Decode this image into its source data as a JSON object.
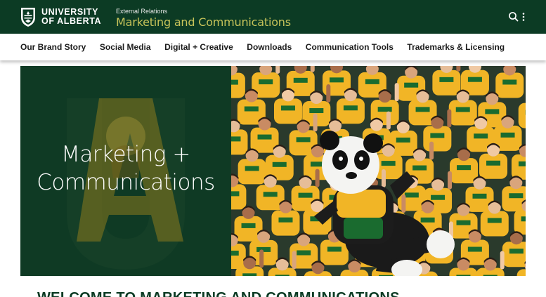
{
  "brand": {
    "logo_line1": "UNIVERSITY",
    "logo_line2": "OF ALBERTA",
    "site_super": "External Relations",
    "site_title": "Marketing and Communications"
  },
  "header_icons": {
    "search": "search-icon",
    "menu": "kebab-menu-icon"
  },
  "nav": {
    "items": [
      "Our Brand Story",
      "Social Media",
      "Digital + Creative",
      "Downloads",
      "Communication Tools",
      "Trademarks & Licensing"
    ]
  },
  "hero": {
    "title_line1": "Marketing +",
    "title_line2": "Communications"
  },
  "welcome_heading": "WELCOME TO MARKETING AND COMMUNICATIONS",
  "colors": {
    "header_bg": "#0c3b24",
    "hero_panel_bg": "#0f3a24",
    "title_gold": "#c7c35a",
    "shirt_gold": "#f1b526",
    "shirt_green": "#1a6b2f"
  }
}
